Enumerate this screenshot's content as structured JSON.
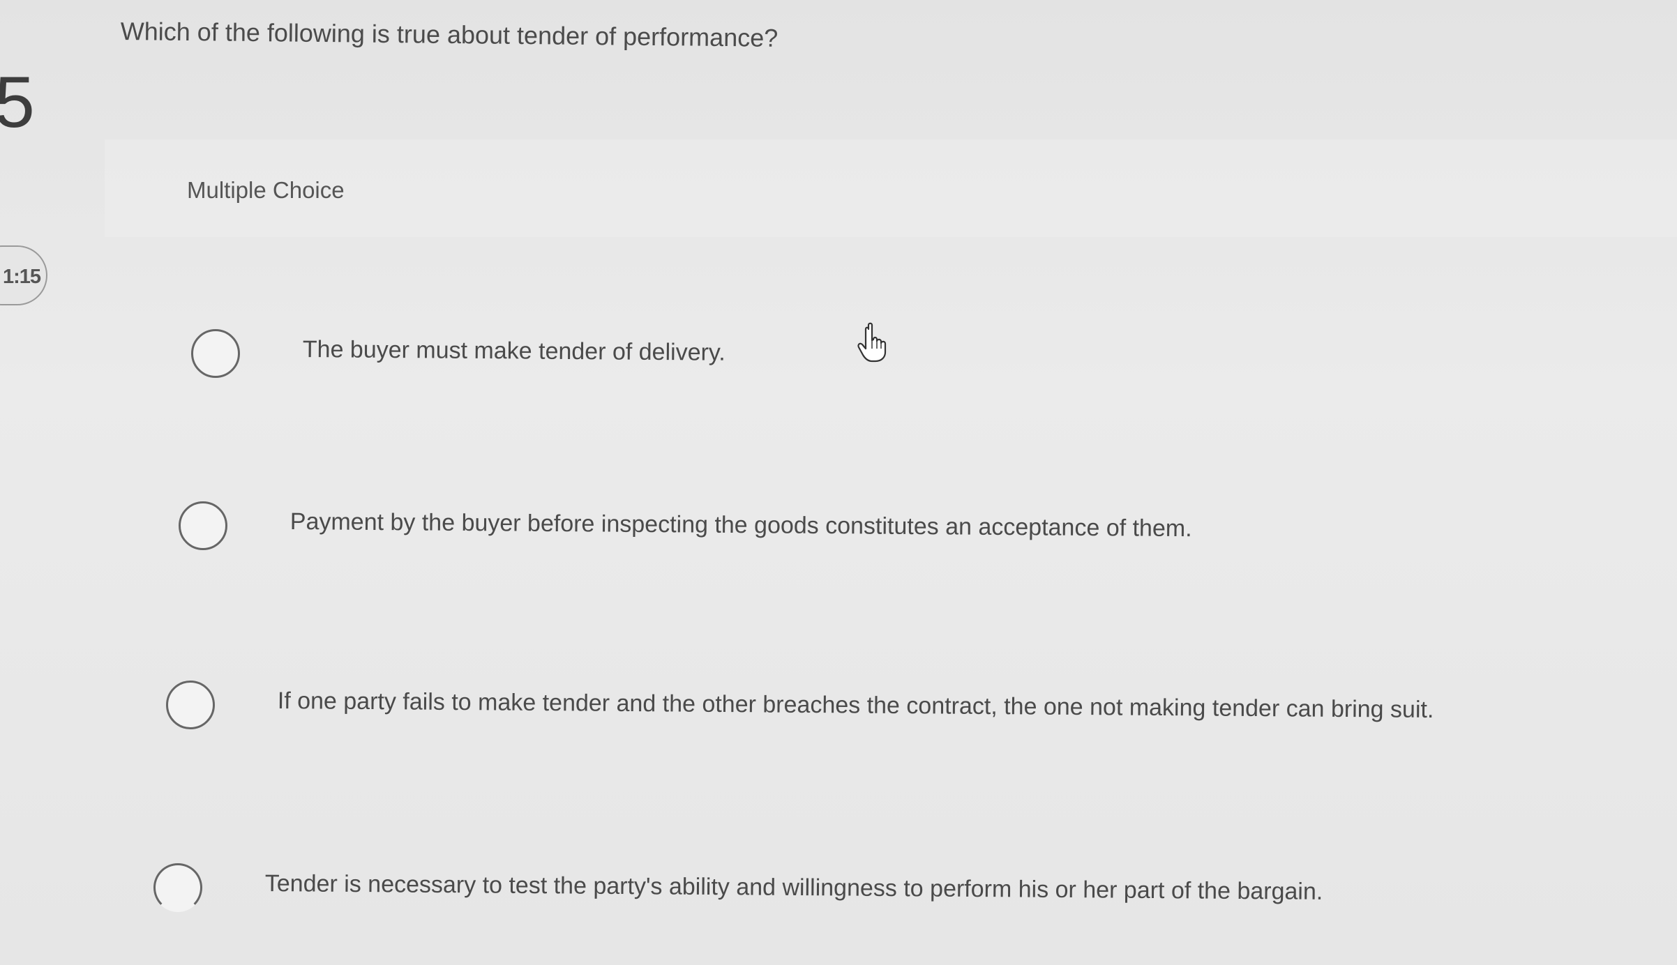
{
  "left_rail": {
    "question_number": "5",
    "timer": "1:15"
  },
  "question": {
    "text": "Which of the following is true about tender of performance?",
    "type_label": "Multiple Choice"
  },
  "options": [
    {
      "label": "The buyer must make tender of delivery.",
      "selected": false
    },
    {
      "label": "Payment by the buyer before inspecting the goods constitutes an acceptance of them.",
      "selected": false
    },
    {
      "label": "If one party fails to make tender and the other breaches the contract, the one not making tender can bring suit.",
      "selected": false
    },
    {
      "label": "Tender is necessary to test the party's ability and willingness to perform his or her part of the bargain.",
      "selected": false
    }
  ],
  "cursor": {
    "icon": "hand-pointer-icon"
  }
}
